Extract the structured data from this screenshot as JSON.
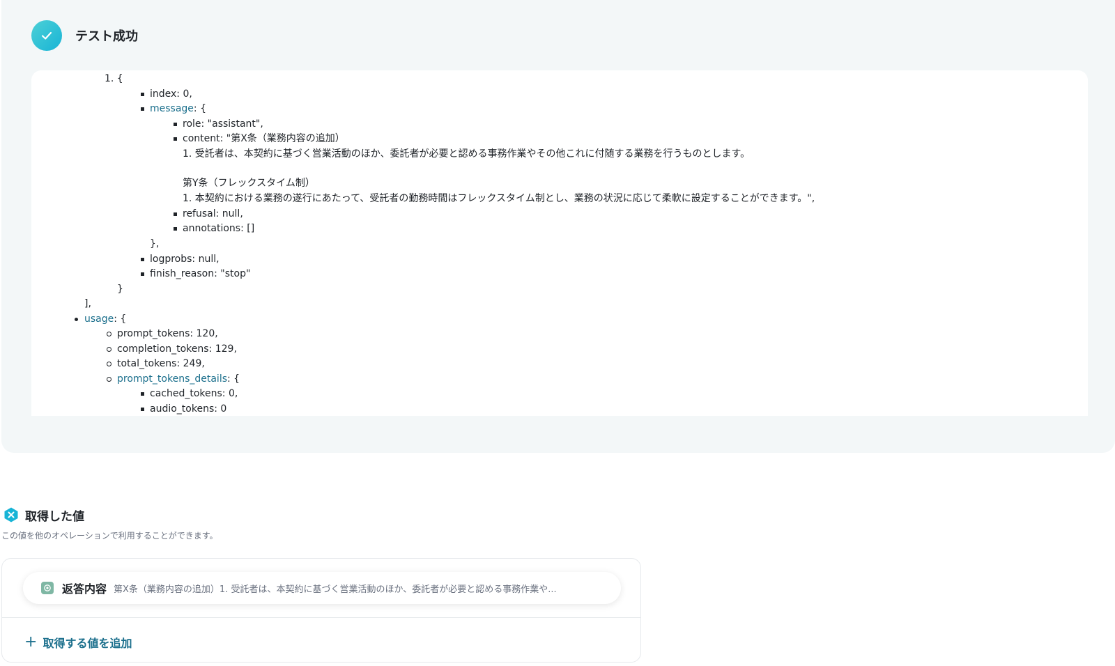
{
  "test_result": {
    "title": "テスト成功"
  },
  "json_lines": [
    "1. {",
    "index: 0,",
    "message",
    ": {",
    "role: \"assistant\",",
    "content: \"第X条（業務内容の追加）",
    "1. 受託者は、本契約に基づく営業活動のほか、委託者が必要と認める事務作業やその他これに付随する業務を行うものとします。",
    "第Y条（フレックスタイム制）",
    "1. 本契約における業務の遂行にあたって、受託者の勤務時間はフレックスタイム制とし、業務の状況に応じて柔軟に設定することができます。\",",
    "refusal: null,",
    "annotations: []",
    "},",
    "logprobs: null,",
    "finish_reason: \"stop\"",
    "}",
    "],",
    "usage",
    ": {",
    "prompt_tokens: 120,",
    "completion_tokens: 129,",
    "total_tokens: 249,",
    "prompt_tokens_details",
    ": {",
    "cached_tokens: 0,",
    "audio_tokens: 0"
  ],
  "values": {
    "title": "取得した値",
    "description": "この値を他のオペレーションで利用することができます。",
    "items": [
      {
        "label": "返答内容",
        "preview": "第X条（業務内容の追加）1. 受託者は、本契約に基づく営業活動のほか、委託者が必要と認める事務作業や..."
      }
    ],
    "add_label": "取得する値を追加"
  },
  "colors": {
    "accent": "#1b6f8c",
    "success": "#18b4d6",
    "panel_bg": "#f3f7f8"
  },
  "icons": {
    "success": "check-circle-icon",
    "values": "variable-badge-icon",
    "item": "openai-icon",
    "add": "plus-icon"
  }
}
